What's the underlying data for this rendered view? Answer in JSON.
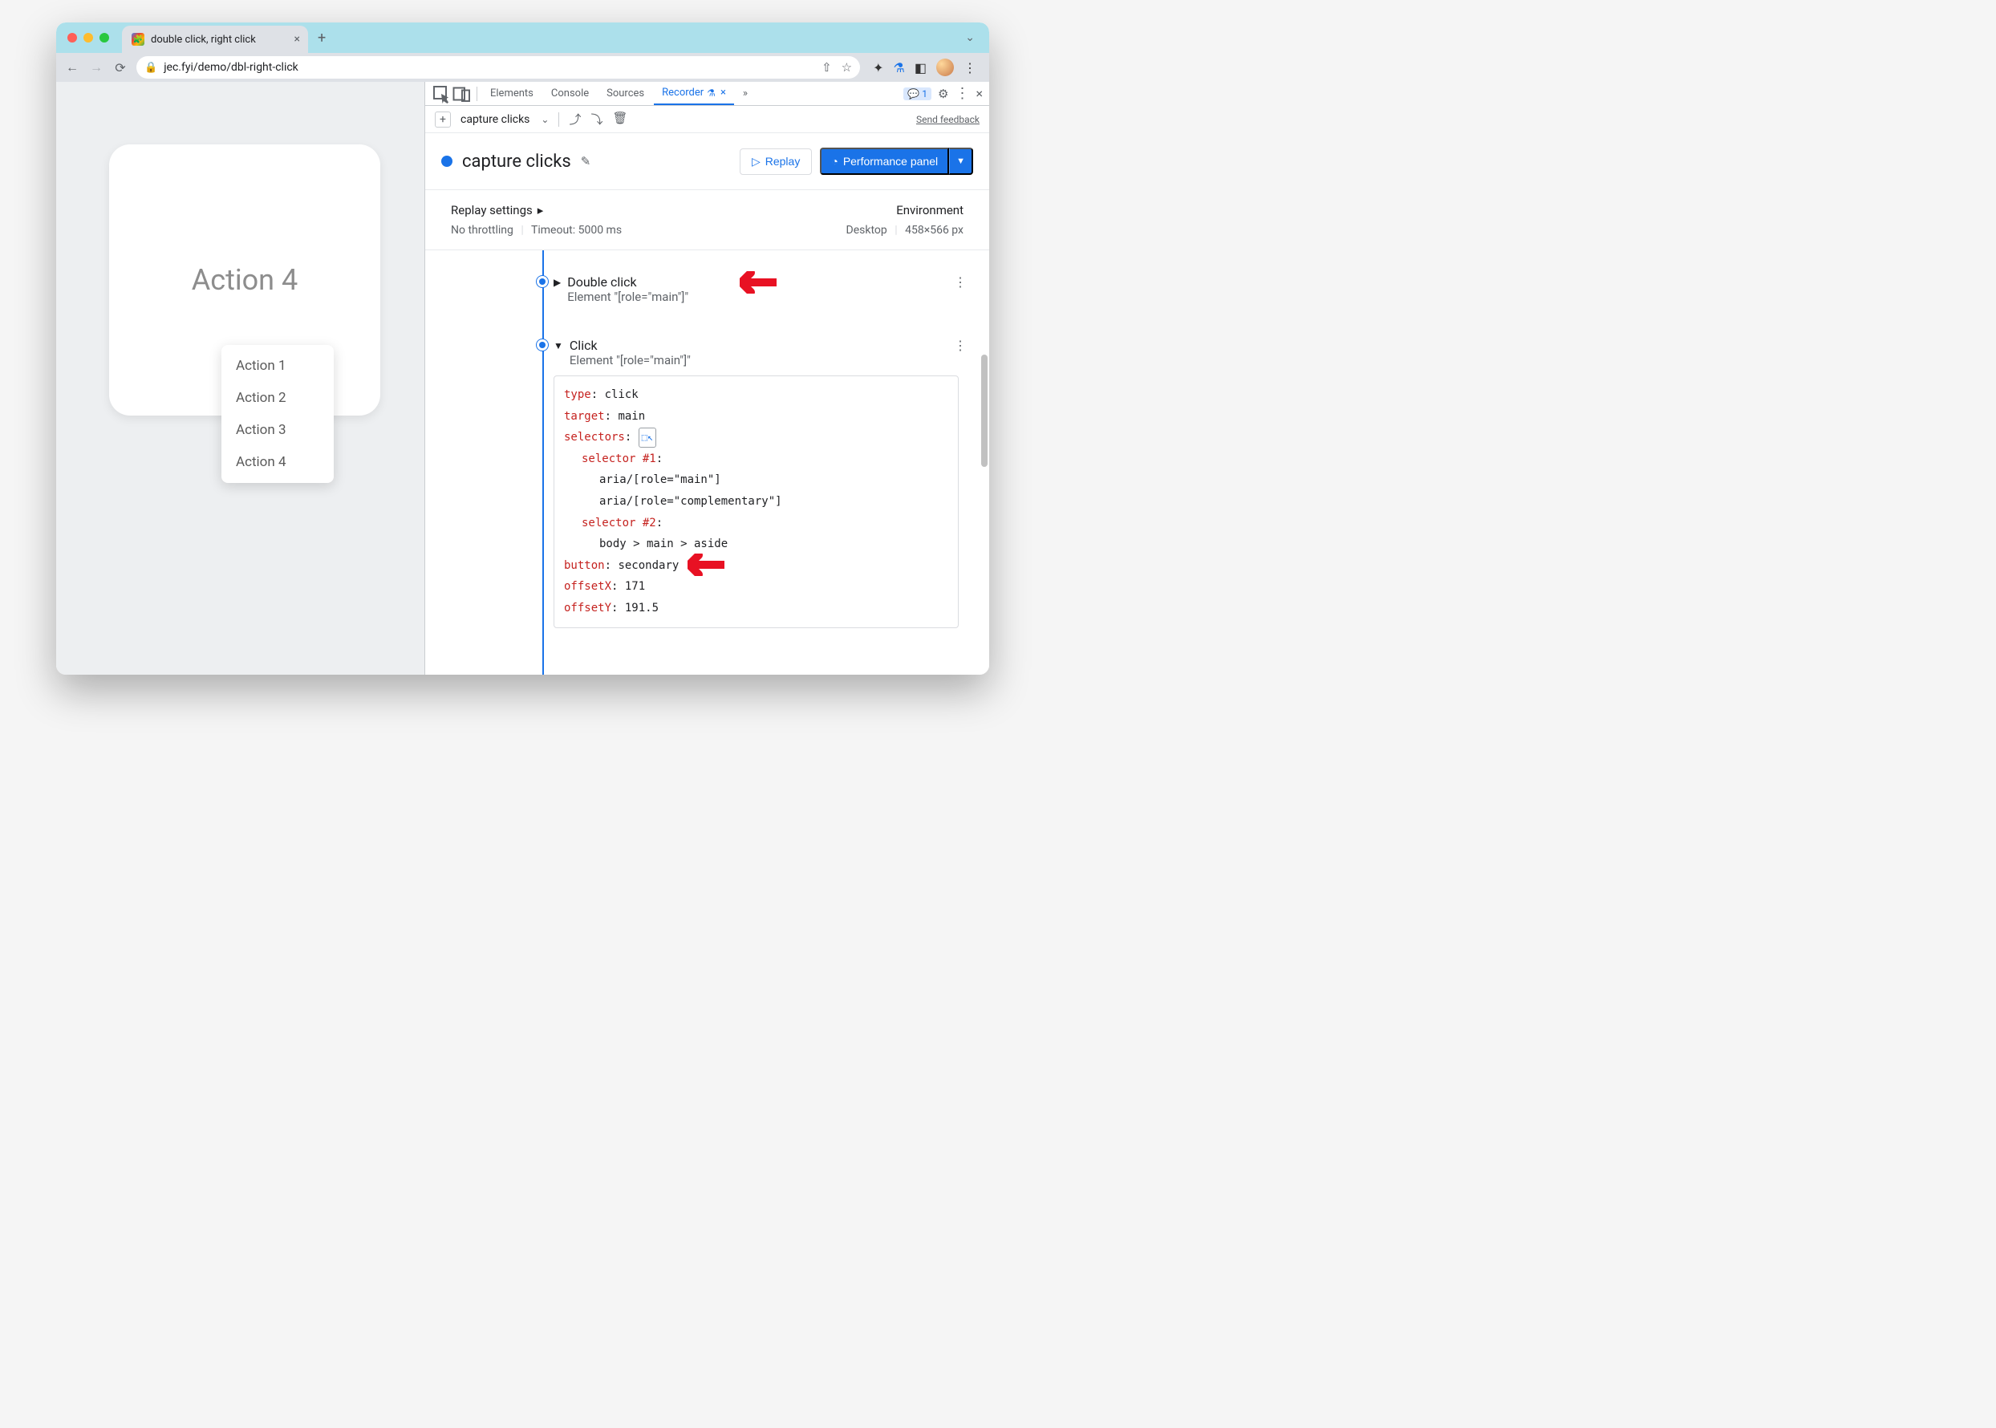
{
  "browser": {
    "tab_title": "double click, right click",
    "url": "jec.fyi/demo/dbl-right-click"
  },
  "page": {
    "card_title": "Action 4",
    "menu_items": [
      "Action 1",
      "Action 2",
      "Action 3",
      "Action 4"
    ]
  },
  "devtools": {
    "tabs": [
      "Elements",
      "Console",
      "Sources",
      "Recorder"
    ],
    "active_tab": "Recorder",
    "issues_count": "1",
    "recording_select": "capture clicks",
    "feedback": "Send feedback",
    "recording_title": "capture clicks",
    "replay_btn": "Replay",
    "perf_btn": "Performance panel",
    "settings": {
      "replay_label": "Replay settings",
      "throttling": "No throttling",
      "timeout": "Timeout: 5000 ms",
      "env_label": "Environment",
      "device": "Desktop",
      "dimensions": "458×566 px"
    },
    "steps": [
      {
        "name": "Double click",
        "element": "Element \"[role=\"main\"]\"",
        "expanded": false
      },
      {
        "name": "Click",
        "element": "Element \"[role=\"main\"]\"",
        "expanded": true,
        "details": {
          "type": "click",
          "target": "main",
          "selectors_label": "selectors",
          "sel1_label": "selector #1",
          "sel1_a": "aria/[role=\"main\"]",
          "sel1_b": "aria/[role=\"complementary\"]",
          "sel2_label": "selector #2",
          "sel2_a": "body > main > aside",
          "button": "secondary",
          "offsetX": "171",
          "offsetY": "191.5"
        }
      }
    ]
  }
}
